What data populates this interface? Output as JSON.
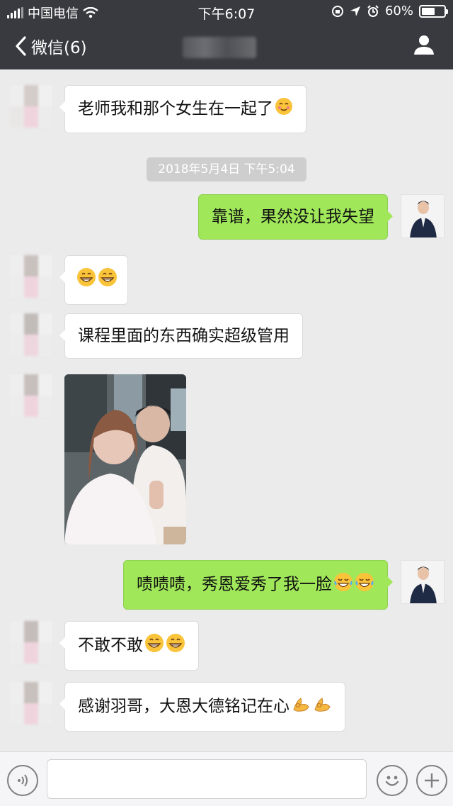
{
  "status_bar": {
    "carrier": "中国电信",
    "time": "下午6:07",
    "battery_percent": "60%",
    "battery_level": 0.6
  },
  "nav": {
    "back_label": "微信(6)"
  },
  "messages": [
    {
      "from": "contact",
      "text": "老师我和那个女生在一起了",
      "emoji": [
        "blush-face"
      ]
    },
    {
      "from": "me",
      "text": "靠谱，果然没让我失望"
    },
    {
      "from": "contact",
      "text": "",
      "emoji": [
        "grin-face",
        "grin-face"
      ]
    },
    {
      "from": "contact",
      "text": "课程里面的东西确实超级管用"
    },
    {
      "from": "contact",
      "type": "photo"
    },
    {
      "from": "me",
      "text": "啧啧啧，秀恩爱秀了我一脸",
      "emoji": [
        "tears-of-joy-face",
        "tears-of-joy-face"
      ]
    },
    {
      "from": "contact",
      "text": "不敢不敢",
      "emoji": [
        "grin-face",
        "grin-face"
      ]
    },
    {
      "from": "contact",
      "text": "感谢羽哥，大恩大德铭记在心",
      "emoji": [
        "ok-hand",
        "ok-hand"
      ]
    }
  ],
  "timestamp": "2018年5月4日 下午5:04",
  "input_bar": {
    "voice_icon": "voice-icon",
    "emoji_icon": "emoji-icon",
    "plus_icon": "plus-icon"
  }
}
